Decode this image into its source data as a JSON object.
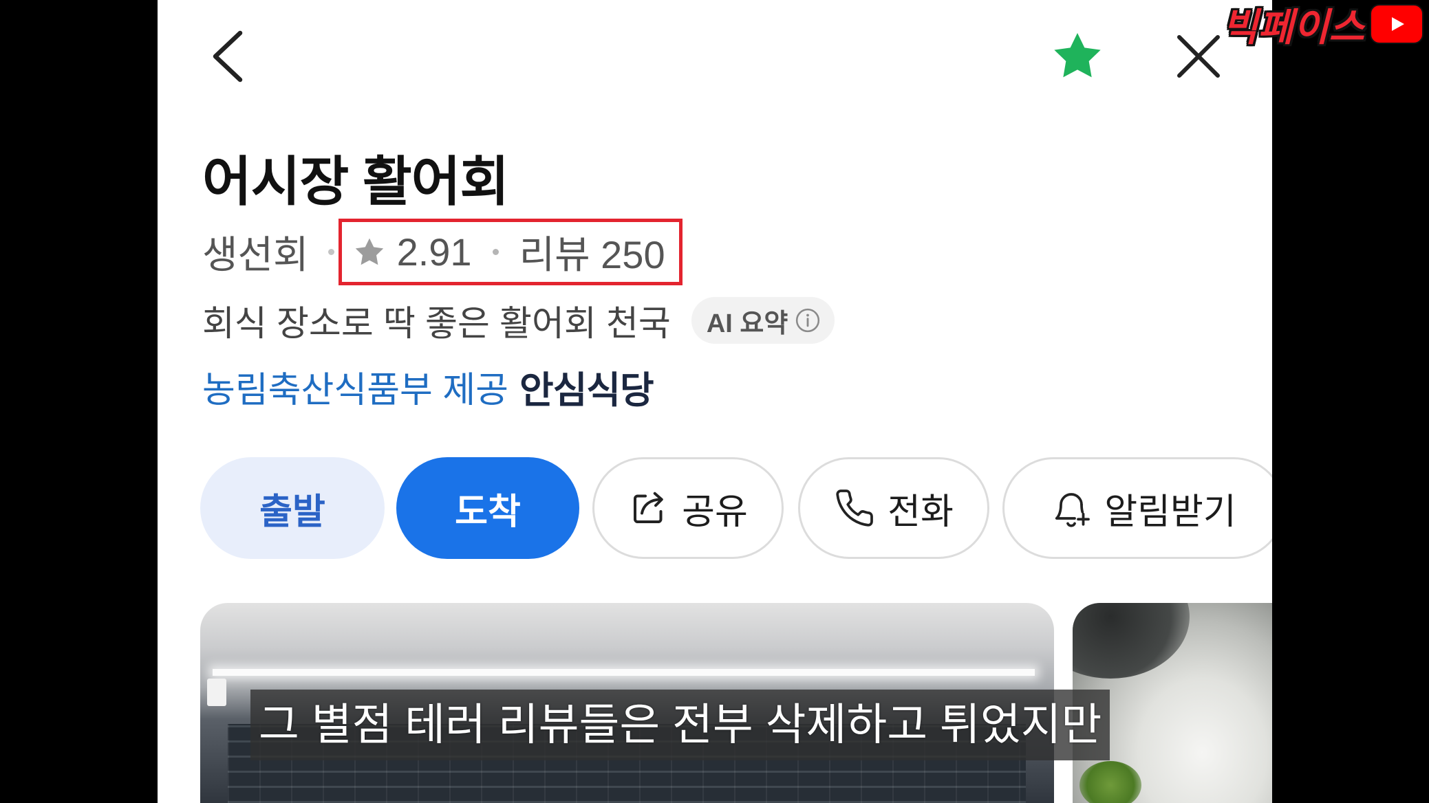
{
  "colors": {
    "accent": "#1a73e8",
    "accent_soft": "#e8eefb",
    "accent_text": "#2b63c6",
    "highlight": "#e3242f",
    "favorite": "#1fb35b",
    "link_blue": "#1f6dc2",
    "certified_navy": "#1b2740"
  },
  "header": {
    "back_icon": "chevron-left-icon",
    "favorite_icon": "star-icon",
    "close_icon": "close-icon"
  },
  "channel_logo": {
    "text": "빅페이스",
    "icon": "youtube-play-icon"
  },
  "place": {
    "name": "어시장 활어회",
    "category": "생선회",
    "rating_icon": "star-icon",
    "rating": "2.91",
    "review_count": "리뷰 250",
    "summary": "회식 장소로 딱 좋은 활어회 천국",
    "ai_summary_label": "AI 요약",
    "ai_summary_icon": "info-icon",
    "certification_provider": "농림축산식품부 제공",
    "certification_name": "안심식당"
  },
  "actions": [
    {
      "label": "출발"
    },
    {
      "label": "도착"
    },
    {
      "label": "공유",
      "icon": "share-icon"
    },
    {
      "label": "전화",
      "icon": "phone-icon"
    },
    {
      "label": "알림받기",
      "icon": "bell-plus-icon"
    }
  ],
  "subtitle": "그 별점 테러 리뷰들은 전부 삭제하고 튀었지만"
}
